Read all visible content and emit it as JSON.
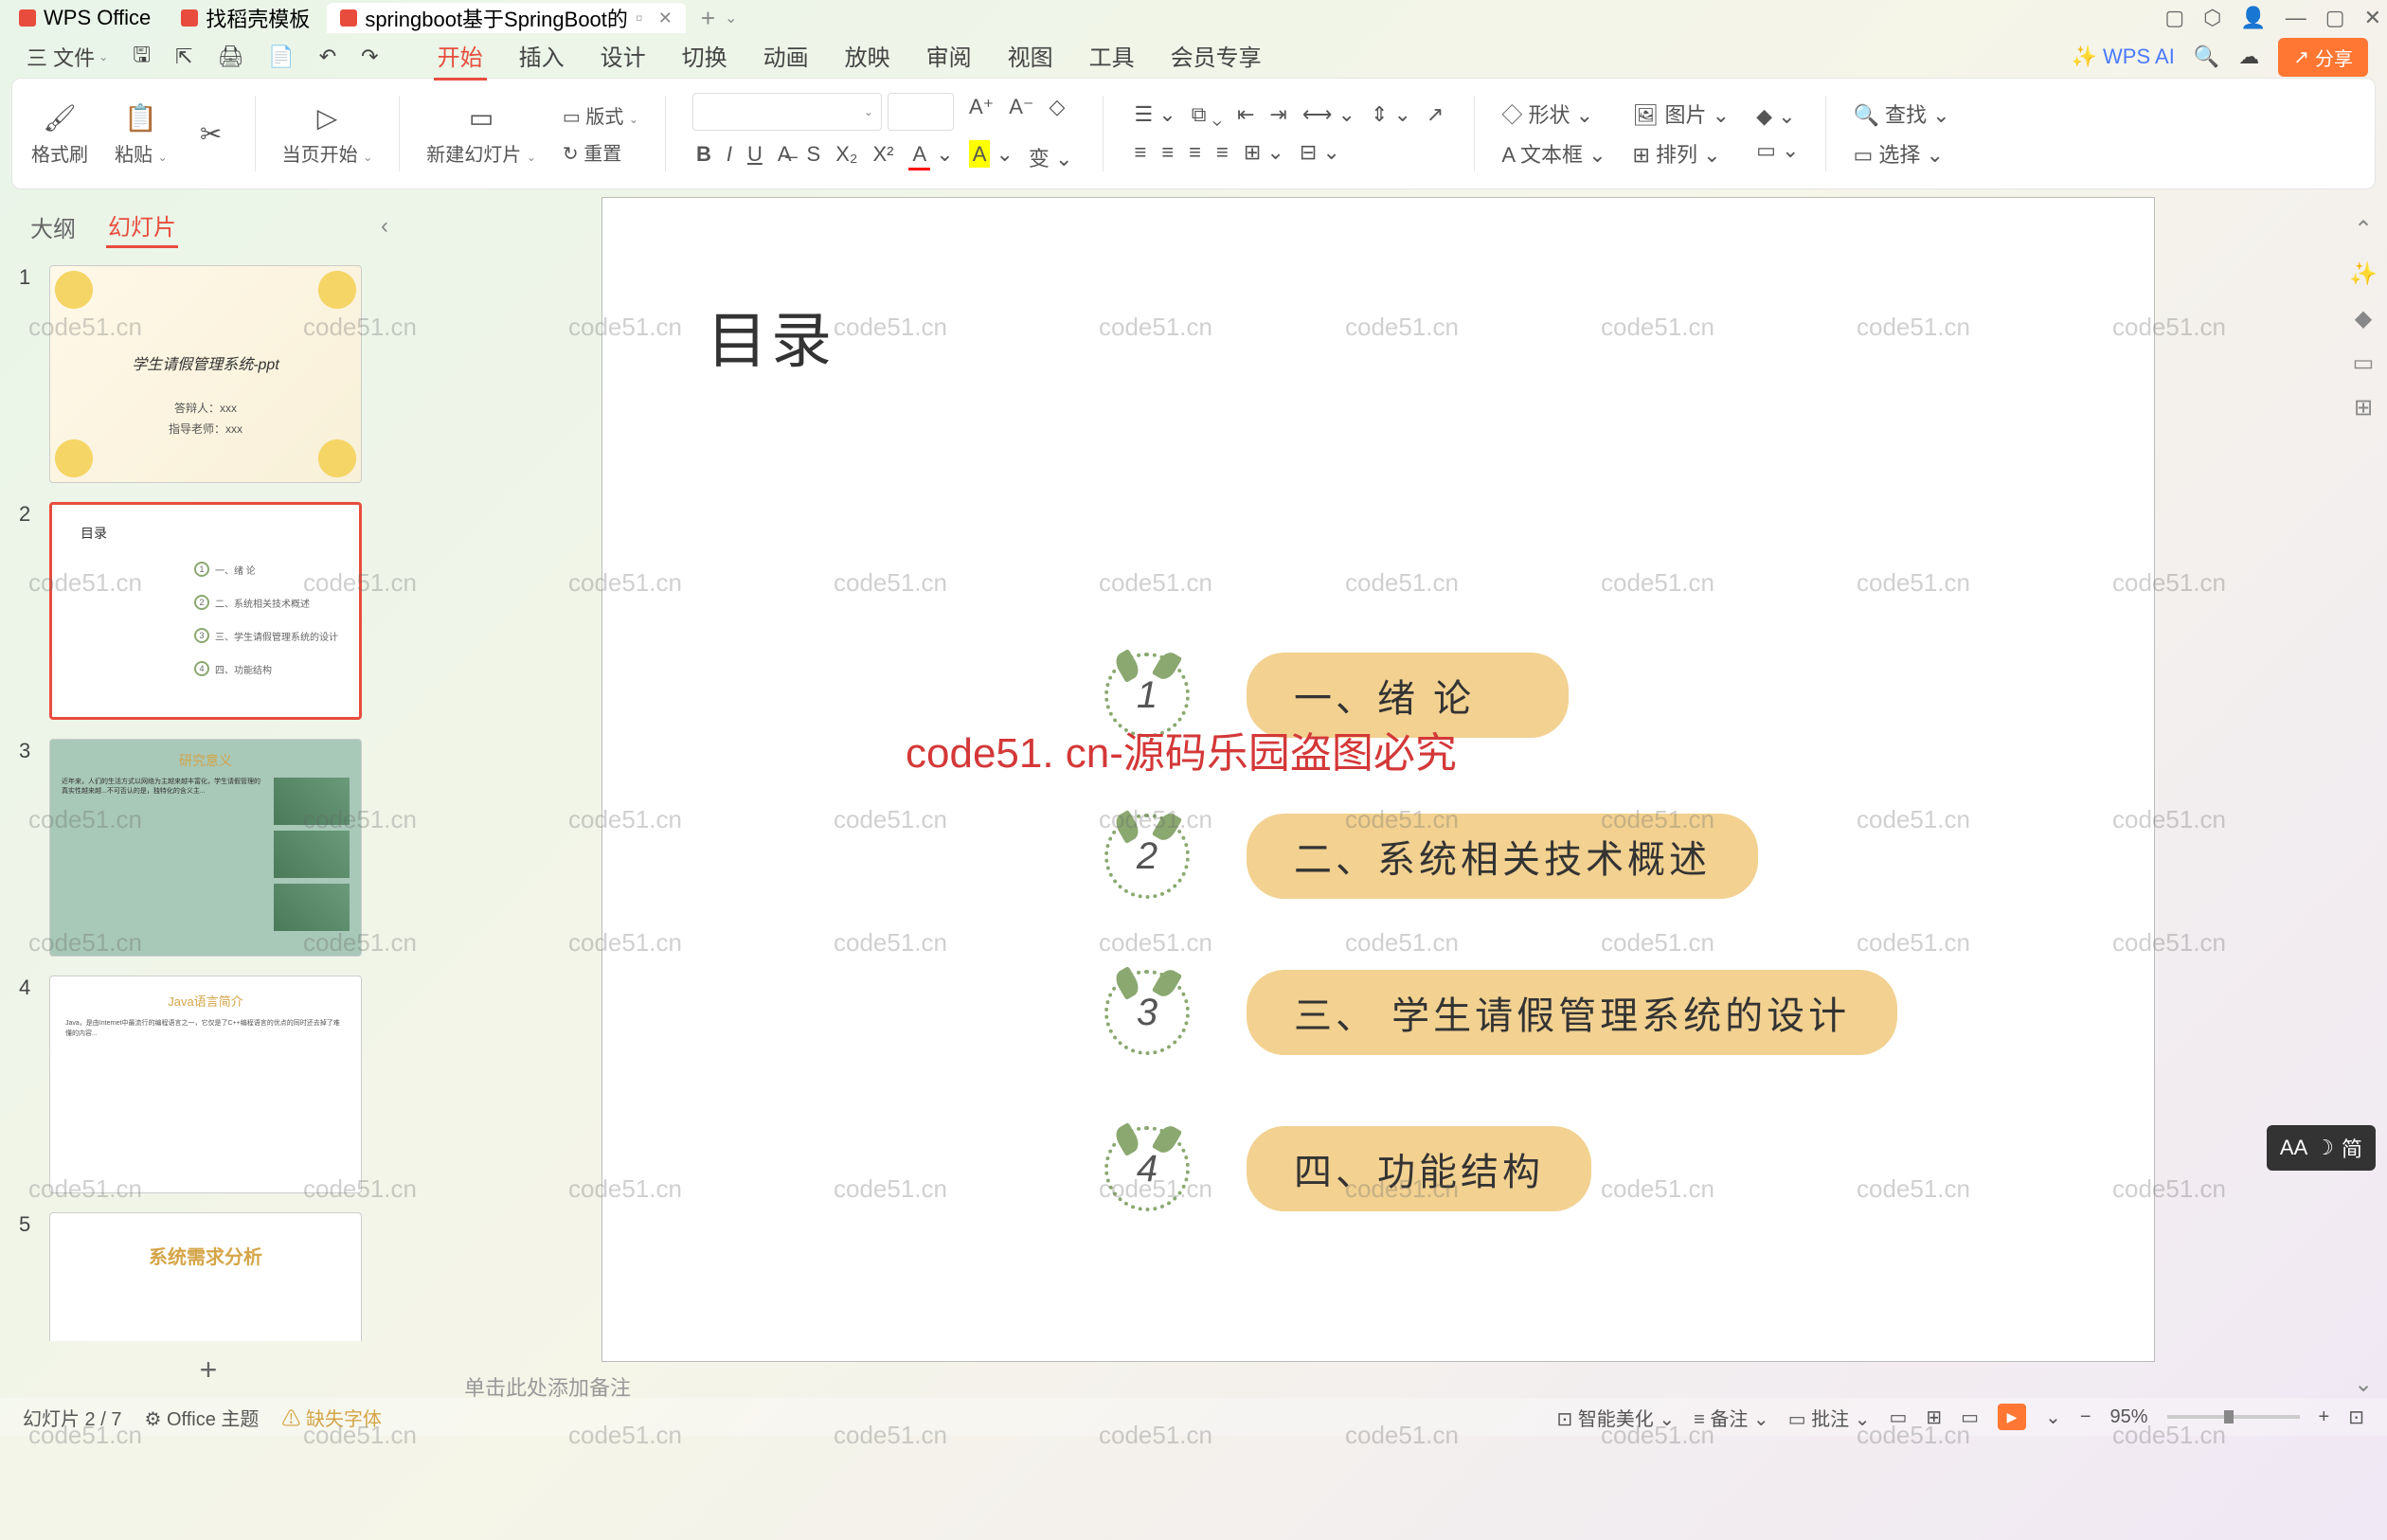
{
  "tabs": {
    "wps": "WPS Office",
    "docer": "找稻壳模板",
    "file": "springboot基于SpringBoot的"
  },
  "window_controls": {
    "min": "—",
    "max": "▢",
    "close": "✕"
  },
  "quickbar": {
    "menu": "三 文件",
    "arrow": "⌄"
  },
  "menus": {
    "start": "开始",
    "insert": "插入",
    "design": "设计",
    "transition": "切换",
    "animation": "动画",
    "slideshow": "放映",
    "review": "审阅",
    "view": "视图",
    "tools": "工具",
    "member": "会员专享",
    "wpsai": "WPS AI"
  },
  "share": "分享",
  "ribbon": {
    "format_painter": "格式刷",
    "paste": "粘贴",
    "from_current": "当页开始",
    "new_slide": "新建幻灯片",
    "layout": "版式",
    "reset": "重置",
    "shape": "形状",
    "image": "图片",
    "textbox": "文本框",
    "arrange": "排列",
    "find": "查找",
    "select": "选择"
  },
  "panel": {
    "outline": "大纲",
    "slides": "幻灯片"
  },
  "thumbs": {
    "t1_title": "学生请假管理系统-ppt",
    "t1_author": "答辩人：xxx",
    "t1_teacher": "指导老师：xxx",
    "t2_title": "目录",
    "t2_i1": "一、绪 论",
    "t2_i2": "二、系统相关技术概述",
    "t2_i3": "三、学生请假管理系统的设计",
    "t2_i4": "四、功能结构",
    "t3_title": "研究意义",
    "t4_title": "Java语言简介",
    "t5_title": "系统需求分析"
  },
  "slide": {
    "title": "目录",
    "items": [
      {
        "num": "1",
        "label": "一、绪  论"
      },
      {
        "num": "2",
        "label": "二、系统相关技术概述"
      },
      {
        "num": "3",
        "label": "三、 学生请假管理系统的设计"
      },
      {
        "num": "4",
        "label": "四、功能结构"
      }
    ],
    "watermark_center": "code51. cn-源码乐园盗图必究"
  },
  "notes_placeholder": "单击此处添加备注",
  "status": {
    "slide_count": "幻灯片 2 / 7",
    "theme": "Office 主题",
    "missing_font": "缺失字体",
    "beautify": "智能美化",
    "notes": "备注",
    "review": "批注",
    "zoom": "95%"
  },
  "ime": {
    "aa": "AA",
    "lang": "简"
  },
  "watermark": "code51.cn"
}
